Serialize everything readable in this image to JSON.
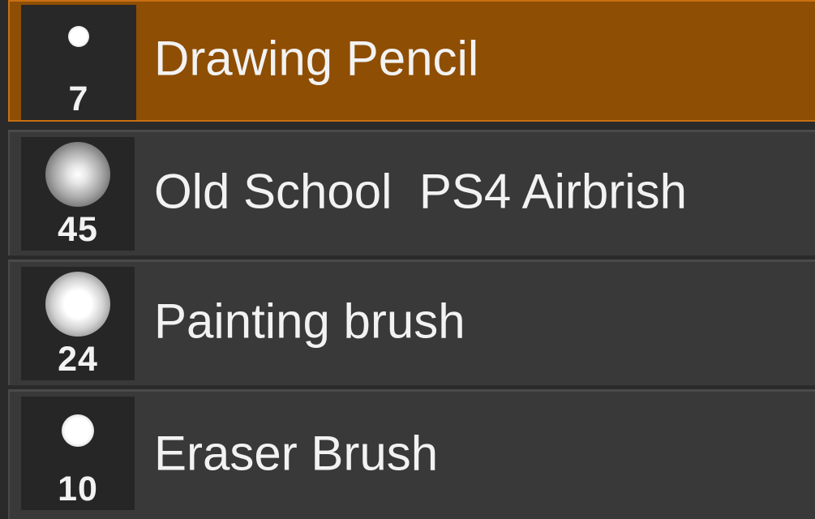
{
  "brushes": [
    {
      "name": "Drawing Pencil",
      "size": "7",
      "tip": "hard",
      "selected": true
    },
    {
      "name": "Old School  PS4 Airbrish",
      "size": "45",
      "tip": "soft",
      "selected": false
    },
    {
      "name": "Painting brush",
      "size": "24",
      "tip": "medium",
      "selected": false
    },
    {
      "name": "Eraser Brush",
      "size": "10",
      "tip": "hard",
      "selected": false
    }
  ],
  "colors": {
    "selected_row": "#8e4e04",
    "selected_border": "#c86f12",
    "row": "#393939",
    "thumbnail": "#262626",
    "text": "#f2f2f2"
  }
}
